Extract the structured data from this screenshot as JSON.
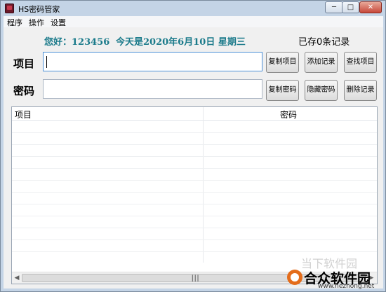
{
  "window": {
    "title": "HS密码管家"
  },
  "menu": [
    "程序",
    "操作",
    "设置"
  ],
  "header": {
    "greeting": "您好：123456",
    "date": "今天是2020年6月10日 星期三",
    "record_count": "已存0条记录"
  },
  "form": {
    "item_label": "项目",
    "item_value": "",
    "password_label": "密码",
    "password_value": ""
  },
  "buttons": {
    "copy_item": "复制项目",
    "add_record": "添加记录",
    "find_item": "查找项目",
    "copy_password": "复制密码",
    "hide_password": "隐藏密码",
    "delete_record": "删除记录"
  },
  "table": {
    "columns": [
      "项目",
      "密码"
    ],
    "rows": []
  },
  "watermark": {
    "top": "当下软件园",
    "main": "合众软件园",
    "url": "www.hezhong.net"
  },
  "colors": {
    "accent_text": "#1a7a8a",
    "frame": "#c4d4e6",
    "close_button": "#c7483a"
  },
  "icons": [
    "app-icon",
    "minimize-icon",
    "maximize-icon",
    "close-icon",
    "scroll-left-icon",
    "scroll-right-icon"
  ]
}
